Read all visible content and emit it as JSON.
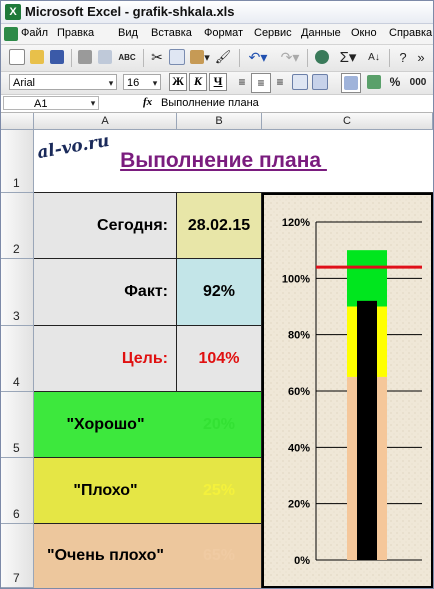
{
  "window": {
    "title": "Microsoft Excel - grafik-shkala.xls",
    "app_icon_letter": "X"
  },
  "menu": [
    "Файл",
    "Правка",
    "Вид",
    "Вставка",
    "Формат",
    "Сервис",
    "Данные",
    "Окно",
    "Справка"
  ],
  "toolbar": {
    "font_name": "Arial",
    "font_size": "16",
    "bold_label": "Ж",
    "italic_label": "К",
    "underline_label": "Ч",
    "sigma_label": "Σ",
    "percent_label": "%",
    "thousands_label": "000"
  },
  "formula_bar": {
    "cell_ref": "A1",
    "fx_label": "fx",
    "content": "Выполнение плана"
  },
  "sheet": {
    "columns": [
      "A",
      "B",
      "C"
    ],
    "rows": [
      "1",
      "2",
      "3",
      "4",
      "5",
      "6",
      "7"
    ],
    "watermark": "al-vo.ru",
    "title": "Выполнение плана ",
    "today_label": "Сегодня:",
    "today_value": "28.02.15",
    "fact_label": "Факт:",
    "fact_value": "92%",
    "goal_label": "Цель:",
    "goal_value": "104%",
    "good_label": "\"Хорошо\"",
    "good_value": "20%",
    "bad_label": "\"Плохо\"",
    "bad_value": "25%",
    "very_bad_label": "\"Очень плохо\"",
    "very_bad_value": "65%"
  },
  "colors": {
    "good_fill": "#3de83d",
    "bad_fill": "#e5e645",
    "very_bad_fill": "#edc79d",
    "label_fill": "#e6e6e6",
    "today_fill": "#e8e6a8",
    "fact_fill": "#c3e5e8",
    "goal_text": "#e01010",
    "title_text": "#7a1c7e",
    "chart_bg": "#efe7d7"
  },
  "chart_data": {
    "type": "bar",
    "subtype": "stacked-bullet",
    "y_tick_labels": [
      "0%",
      "20%",
      "40%",
      "60%",
      "80%",
      "100%",
      "120%"
    ],
    "ylim": [
      0,
      120
    ],
    "grid": true,
    "bands": [
      {
        "name": "Очень плохо",
        "value": 65,
        "color": "#f5c79a"
      },
      {
        "name": "Плохо",
        "value": 25,
        "color": "#ffff00"
      },
      {
        "name": "Хорошо",
        "value": 20,
        "color": "#00e61e"
      }
    ],
    "actual": {
      "value": 92,
      "color": "#000000"
    },
    "target": {
      "value": 104,
      "color": "#e0101a"
    }
  }
}
